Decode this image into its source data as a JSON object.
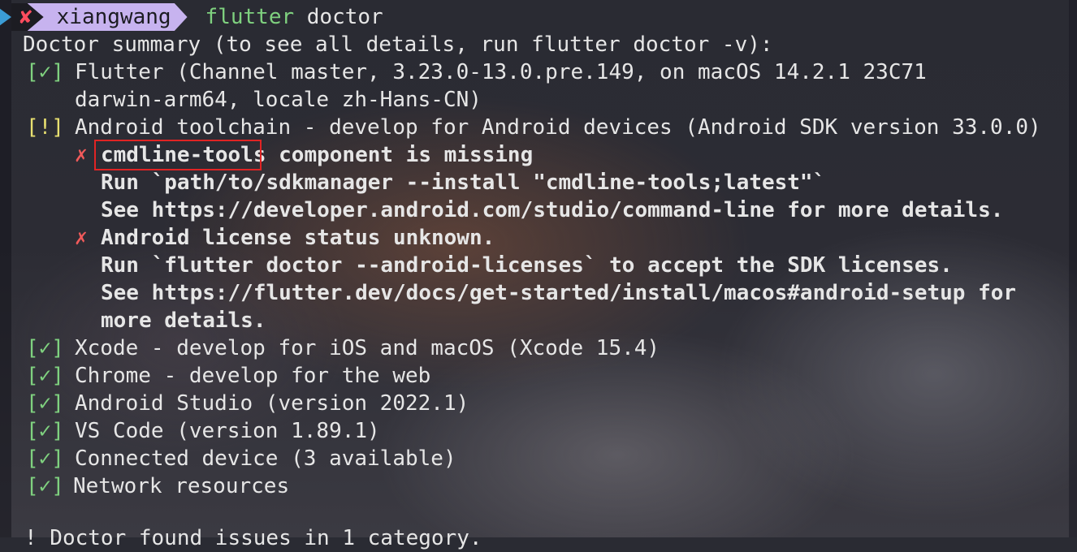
{
  "prompt": {
    "status_icon": "✘",
    "user": "xiangwang",
    "command_bin": "flutter",
    "command_args": " doctor"
  },
  "lines": {
    "summary": "Doctor summary (to see all details, run flutter doctor -v):",
    "ok_mark": "[✓]",
    "warn_mark": "[!]",
    "x_mark": "✗",
    "flutter_1": "Flutter (Channel master, 3.23.0-13.0.pre.149, on macOS 14.2.1 23C71",
    "flutter_2": "darwin-arm64, locale zh-Hans-CN)",
    "android": "Android toolchain - develop for Android devices (Android SDK version 33.0.0)",
    "cmdline_missing_a": "cmdline-tools",
    "cmdline_missing_b": " component is missing",
    "run_sdkmanager": "Run `path/to/sdkmanager --install \"cmdline-tools;latest\"`",
    "see_cmdline": "See https://developer.android.com/studio/command-line for more details.",
    "license_unknown": "Android license status unknown.",
    "run_licenses": "Run `flutter doctor --android-licenses` to accept the SDK licenses.",
    "see_setup": "See https://flutter.dev/docs/get-started/install/macos#android-setup for",
    "more_details": "more details.",
    "xcode": "Xcode - develop for iOS and macOS (Xcode 15.4)",
    "chrome": "Chrome - develop for the web",
    "studio": "Android Studio (version 2022.1)",
    "vscode": "VS Code (version 1.89.1)",
    "device": "Connected device (3 available)",
    "network": "Network resources",
    "found_issues": "! Doctor found issues in 1 category."
  },
  "colors": {
    "ok": "#7fd17f",
    "warn": "#e8e070",
    "error": "#f05a5a",
    "highlight_box": "#e02424"
  }
}
